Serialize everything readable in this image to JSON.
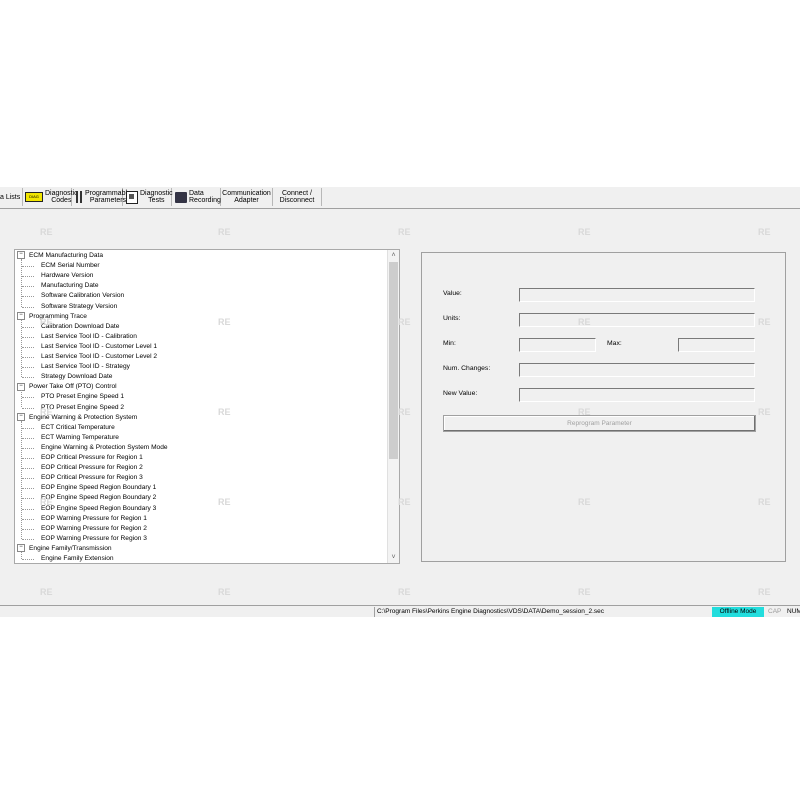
{
  "toolbar": {
    "data_lists": "a Lists",
    "diagnostic_codes": "Diagnostic\nCodes",
    "dtc_badge": "DIAG",
    "programmable_parameters": "Programmable\nParameters",
    "diagnostic_tests": "Diagnostic\nTests",
    "data_recording": "Data\nRecording",
    "communication_adapter": "Communication\nAdapter",
    "connect_disconnect": "Connect /\nDisconnect"
  },
  "tree": {
    "groups": [
      {
        "label": "ECM Manufacturing Data",
        "children": [
          "ECM Serial Number",
          "Hardware Version",
          "Manufacturing Date",
          "Software Calibration Version",
          "Software Strategy Version"
        ]
      },
      {
        "label": "Programming Trace",
        "children": [
          "Calibration Download Date",
          "Last Service Tool ID - Calibration",
          "Last Service Tool ID - Customer Level 1",
          "Last Service Tool ID - Customer Level 2",
          "Last Service Tool ID - Strategy",
          "Strategy Download Date"
        ]
      },
      {
        "label": "Power Take Off (PTO) Control",
        "children": [
          "PTO Preset Engine Speed 1",
          "PTO Preset Engine Speed 2"
        ]
      },
      {
        "label": "Engine Warning & Protection System",
        "children": [
          "ECT Critical Temperature",
          "ECT Warning Temperature",
          "Engine Warning & Protection System Mode",
          "EOP Critical Pressure for Region 1",
          "EOP Critical Pressure for Region 2",
          "EOP Critical Pressure for Region 3",
          "EOP Engine Speed Region Boundary 1",
          "EOP Engine Speed Region Boundary 2",
          "EOP Engine Speed Region Boundary 3",
          "EOP Warning Pressure for Region 1",
          "EOP Warning Pressure for Region 2",
          "EOP Warning Pressure for Region 3"
        ]
      },
      {
        "label": "Engine Family/Transmission",
        "children": [
          "Engine Family Extension"
        ]
      }
    ],
    "expander": "−",
    "scroll_up": "˄",
    "scroll_down": "˅"
  },
  "panel": {
    "value_label": "Value:",
    "units_label": "Units:",
    "min_label": "Min:",
    "max_label": "Max:",
    "num_changes_label": "Num. Changes:",
    "new_value_label": "New Value:",
    "reprogram_button": "Reprogram Parameter"
  },
  "status": {
    "path": "C:\\Program Files\\Perkins Engine Diagnostics\\VDS\\DATA\\Demo_session_2.sec",
    "mode": "Offline Mode",
    "cap": "CAP",
    "num": "NUM"
  },
  "watermark": "RE"
}
